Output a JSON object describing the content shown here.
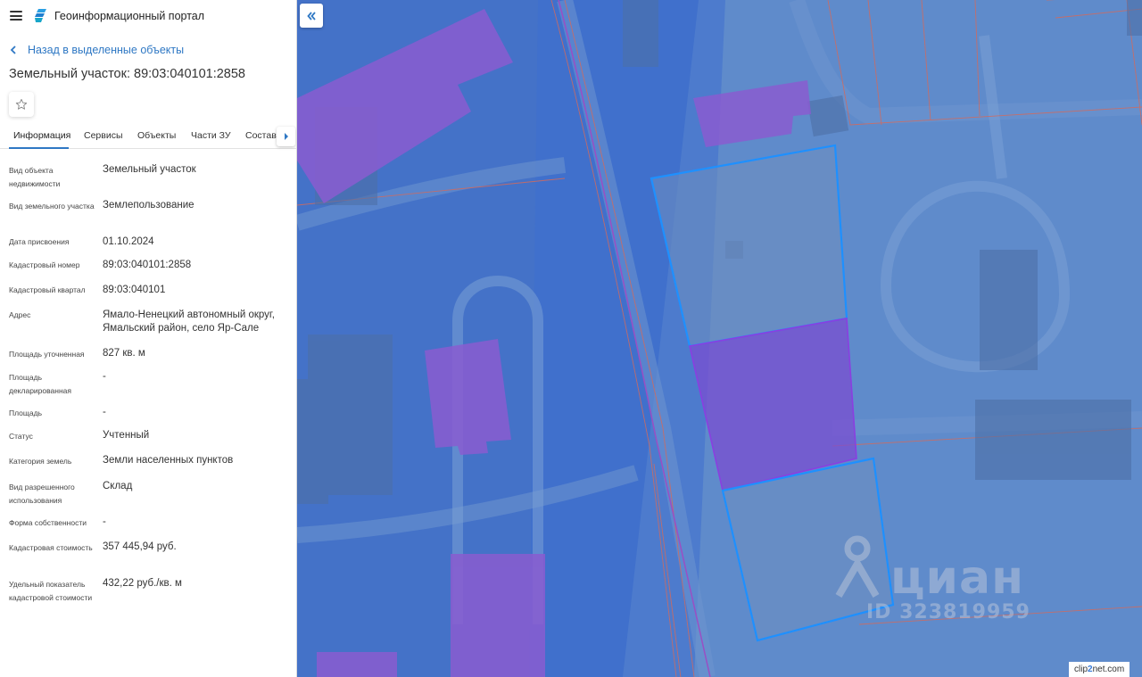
{
  "header": {
    "app_title": "Геоинформационный портал",
    "menu_icon": "menu-icon",
    "logo_icon": "portal-logo-icon"
  },
  "navigation": {
    "back_label": "Назад в выделенные объекты"
  },
  "object": {
    "title": "Земельный участок: 89:03:040101:2858",
    "favorite_icon": "star-icon"
  },
  "tabs": [
    {
      "label": "Информация",
      "active": true
    },
    {
      "label": "Сервисы"
    },
    {
      "label": "Объекты"
    },
    {
      "label": "Части ЗУ"
    },
    {
      "label": "Состав"
    }
  ],
  "properties": [
    {
      "label": "Вид объекта недвижимости",
      "value": "Земельный участок"
    },
    {
      "label": "Вид земельного участка",
      "value": "Землепользование"
    },
    {
      "label": "Дата присвоения",
      "value": "01.10.2024"
    },
    {
      "label": "Кадастровый номер",
      "value": "89:03:040101:2858"
    },
    {
      "label": "Кадастровый квартал",
      "value": "89:03:040101"
    },
    {
      "label": "Адрес",
      "value": "Ямало-Ненецкий автономный округ, Ямальский район, село Яр-Сале"
    },
    {
      "label": "Площадь уточненная",
      "value": "827 кв. м"
    },
    {
      "label": "Площадь декларированная",
      "value": "-"
    },
    {
      "label": "Площадь",
      "value": "-"
    },
    {
      "label": "Статус",
      "value": "Учтенный"
    },
    {
      "label": "Категория земель",
      "value": "Земли населенных пунктов"
    },
    {
      "label": "Вид разрешенного использования",
      "value": "Склад"
    },
    {
      "label": "Форма собственности",
      "value": "-"
    },
    {
      "label": "Кадастровая стоимость",
      "value": "357 445,94 руб."
    },
    {
      "label": "Удельный показатель кадастровой стоимости",
      "value": "432,22 руб./кв. м"
    }
  ],
  "map": {
    "collapse_icon": "double-chevron-left-icon",
    "watermark_brand": "циан",
    "watermark_id": "ID 323819959",
    "clip_badge_prefix": "clip",
    "clip_badge_suffix": "2net.com",
    "colors": {
      "base": "#5c88c8",
      "building": "#8a5cd0",
      "parcel_outline": "#1e90ff",
      "boundary": "#d46a5c"
    }
  }
}
